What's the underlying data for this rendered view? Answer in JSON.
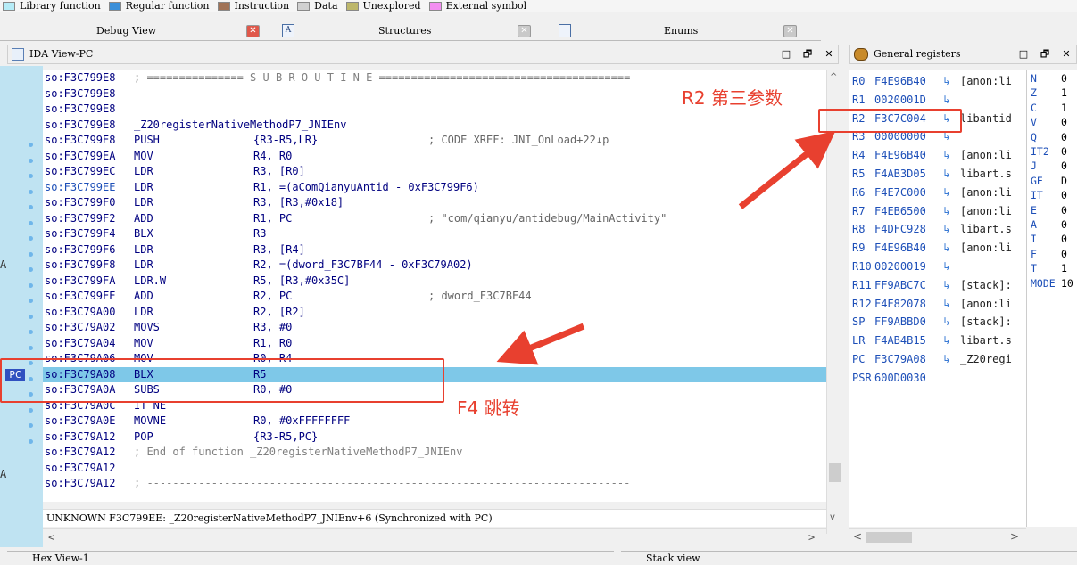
{
  "legend": [
    {
      "label": "Library function",
      "color": "#b6ecf7"
    },
    {
      "label": "Regular function",
      "color": "#3a8fd9"
    },
    {
      "label": "Instruction",
      "color": "#a17357"
    },
    {
      "label": "Data",
      "color": "#d0d0d0"
    },
    {
      "label": "Unexplored",
      "color": "#bdb76b"
    },
    {
      "label": "External symbol",
      "color": "#f38ef1"
    }
  ],
  "tabs": {
    "debug_view": "Debug View",
    "structures": "Structures",
    "enums": "Enums",
    "structures_icon": "A",
    "close_glyph": "✕"
  },
  "ida_view": {
    "title": "IDA View-PC",
    "controls": [
      "□",
      "🗗",
      "✕"
    ],
    "pc_label": "PC",
    "status": "UNKNOWN F3C799EE: _Z20registerNativeMethodP7_JNIEnv+6 (Synchronized with PC)"
  },
  "code_lines": [
    {
      "addr": "so:F3C799E8",
      "mn": "; =============== S U B R O U T I N E =======================================",
      "op": "",
      "cm": "",
      "style": "grey"
    },
    {
      "addr": "so:F3C799E8",
      "mn": "",
      "op": "",
      "cm": ""
    },
    {
      "addr": "so:F3C799E8",
      "mn": "",
      "op": "",
      "cm": ""
    },
    {
      "addr": "so:F3C799E8",
      "mn": "_Z20registerNativeMethodP7_JNIEnv",
      "op": "",
      "cm": ""
    },
    {
      "addr": "so:F3C799E8",
      "mn": "PUSH",
      "op": "{R3-R5,LR}",
      "cm": "; CODE XREF: JNI_OnLoad+22↓p",
      "cmstyle": "green"
    },
    {
      "addr": "so:F3C799EA",
      "mn": "MOV",
      "op": "R4, R0",
      "cm": ""
    },
    {
      "addr": "so:F3C799EC",
      "mn": "LDR",
      "op": "R3, [R0]",
      "cm": ""
    },
    {
      "addr": "so:F3C799EE",
      "mn": "LDR",
      "op": "R1, =(aComQianyuAntid - 0xF3C799F6)",
      "cm": "",
      "addrstyle": "blue"
    },
    {
      "addr": "so:F3C799F0",
      "mn": "LDR",
      "op": "R3, [R3,#0x18]",
      "cm": ""
    },
    {
      "addr": "so:F3C799F2",
      "mn": "ADD",
      "op": "R1, PC",
      "cm": "; \"com/qianyu/antidebug/MainActivity\""
    },
    {
      "addr": "so:F3C799F4",
      "mn": "BLX",
      "op": "R3",
      "cm": ""
    },
    {
      "addr": "so:F3C799F6",
      "mn": "LDR",
      "op": "R3, [R4]",
      "cm": ""
    },
    {
      "addr": "so:F3C799F8",
      "mn": "LDR",
      "op": "R2, =(dword_F3C7BF44 - 0xF3C79A02)",
      "cm": ""
    },
    {
      "addr": "so:F3C799FA",
      "mn": "LDR.W",
      "op": "R5, [R3,#0x35C]",
      "cm": ""
    },
    {
      "addr": "so:F3C799FE",
      "mn": "ADD",
      "op": "R2, PC",
      "cm": "; dword_F3C7BF44"
    },
    {
      "addr": "so:F3C79A00",
      "mn": "LDR",
      "op": "R2, [R2]",
      "cm": ""
    },
    {
      "addr": "so:F3C79A02",
      "mn": "MOVS",
      "op": "R3, #0",
      "cm": ""
    },
    {
      "addr": "so:F3C79A04",
      "mn": "MOV",
      "op": "R1, R0",
      "cm": ""
    },
    {
      "addr": "so:F3C79A06",
      "mn": "MOV",
      "op": "R0, R4",
      "cm": ""
    },
    {
      "addr": "so:F3C79A08",
      "mn": "BLX",
      "op": "R5",
      "cm": "",
      "highlight": true
    },
    {
      "addr": "so:F3C79A0A",
      "mn": "SUBS",
      "op": "R0, #0",
      "cm": ""
    },
    {
      "addr": "so:F3C79A0C",
      "mn": "IT NE",
      "op": "",
      "cm": ""
    },
    {
      "addr": "so:F3C79A0E",
      "mn": "MOVNE",
      "op": "R0, #0xFFFFFFFF",
      "cm": ""
    },
    {
      "addr": "so:F3C79A12",
      "mn": "POP",
      "op": "{R3-R5,PC}",
      "cm": ""
    },
    {
      "addr": "so:F3C79A12",
      "mn": "; End of function _Z20registerNativeMethodP7_JNIEnv",
      "op": "",
      "cm": "",
      "style": "grey"
    },
    {
      "addr": "so:F3C79A12",
      "mn": "",
      "op": "",
      "cm": ""
    },
    {
      "addr": "so:F3C79A12",
      "mn": "; ---------------------------------------------------------------------------",
      "op": "",
      "cm": "",
      "style": "grey"
    }
  ],
  "registers_panel": {
    "title": "General registers"
  },
  "registers": [
    {
      "name": "R0",
      "value": "F4E96B40",
      "arrow": "↳",
      "desc": "[anon:li"
    },
    {
      "name": "R1",
      "value": "0020001D",
      "arrow": "↳",
      "desc": ""
    },
    {
      "name": "R2",
      "value": "F3C7C004",
      "arrow": "↳",
      "desc": "libantid"
    },
    {
      "name": "R3",
      "value": "00000000",
      "arrow": "↳",
      "desc": ""
    },
    {
      "name": "R4",
      "value": "F4E96B40",
      "arrow": "↳",
      "desc": "[anon:li"
    },
    {
      "name": "R5",
      "value": "F4AB3D05",
      "arrow": "↳",
      "desc": "libart.s"
    },
    {
      "name": "R6",
      "value": "F4E7C000",
      "arrow": "↳",
      "desc": "[anon:li"
    },
    {
      "name": "R7",
      "value": "F4EB6500",
      "arrow": "↳",
      "desc": "[anon:li"
    },
    {
      "name": "R8",
      "value": "F4DFC928",
      "arrow": "↳",
      "desc": "libart.s"
    },
    {
      "name": "R9",
      "value": "F4E96B40",
      "arrow": "↳",
      "desc": "[anon:li"
    },
    {
      "name": "R10",
      "value": "00200019",
      "arrow": "↳",
      "desc": ""
    },
    {
      "name": "R11",
      "value": "FF9ABC7C",
      "arrow": "↳",
      "desc": "[stack]:"
    },
    {
      "name": "R12",
      "value": "F4E82078",
      "arrow": "↳",
      "desc": "[anon:li"
    },
    {
      "name": "SP",
      "value": "FF9ABBD0",
      "arrow": "↳",
      "desc": "[stack]:"
    },
    {
      "name": "LR",
      "value": "F4AB4B15",
      "arrow": "↳",
      "desc": "libart.s"
    },
    {
      "name": "PC",
      "value": "F3C79A08",
      "arrow": "↳",
      "desc": "_Z20regi"
    },
    {
      "name": "PSR",
      "value": "600D0030",
      "arrow": "",
      "desc": ""
    }
  ],
  "flags": [
    {
      "name": "N",
      "value": "0"
    },
    {
      "name": "Z",
      "value": "1"
    },
    {
      "name": "C",
      "value": "1"
    },
    {
      "name": "V",
      "value": "0"
    },
    {
      "name": "Q",
      "value": "0"
    },
    {
      "name": "IT2",
      "value": "0"
    },
    {
      "name": "J",
      "value": "0"
    },
    {
      "name": "GE",
      "value": "D"
    },
    {
      "name": "IT",
      "value": "0"
    },
    {
      "name": "E",
      "value": "0"
    },
    {
      "name": "A",
      "value": "0"
    },
    {
      "name": "I",
      "value": "0"
    },
    {
      "name": "F",
      "value": "0"
    },
    {
      "name": "T",
      "value": "1"
    },
    {
      "name": "MODE",
      "value": "10"
    }
  ],
  "bottom_panels": {
    "hex_view": "Hex View-1",
    "stack_view": "Stack view"
  },
  "annotations": {
    "r2_note": "R2 第三参数",
    "f4_note": "F4 跳转"
  },
  "scroll": {
    "up": "^",
    "down": "v",
    "left": "<",
    "right": ">"
  },
  "margin_marks": [
    "A",
    "A"
  ]
}
